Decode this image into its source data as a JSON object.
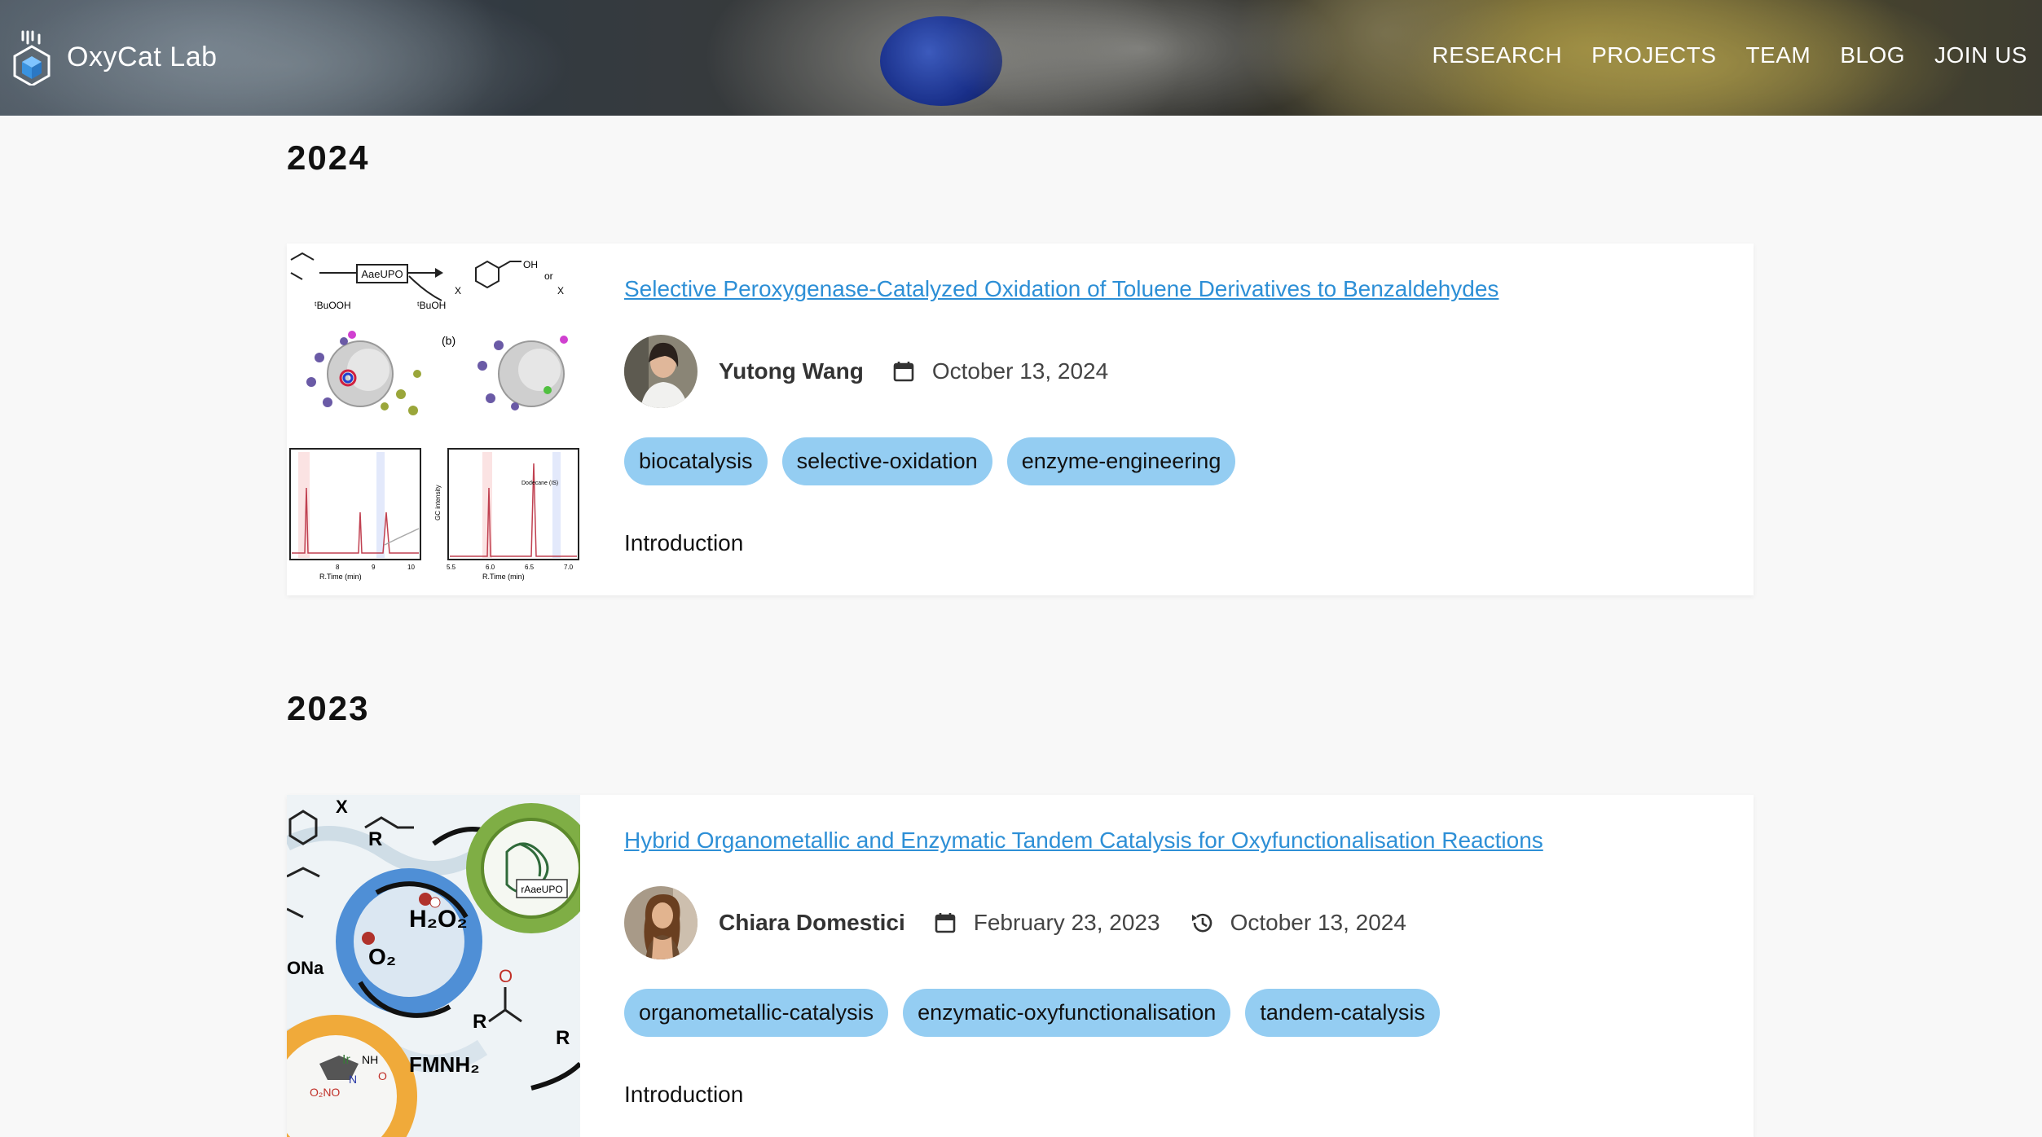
{
  "site": {
    "name": "OxyCat Lab",
    "logo_icon": "flask-cube-icon"
  },
  "nav": {
    "items": [
      {
        "label": "RESEARCH"
      },
      {
        "label": "PROJECTS"
      },
      {
        "label": "TEAM"
      },
      {
        "label": "BLOG"
      },
      {
        "label": "JOIN US"
      }
    ]
  },
  "sections": [
    {
      "year": "2024",
      "posts": [
        {
          "title": "Selective Peroxygenase-Catalyzed Oxidation of Toluene Derivatives to Benzaldehydes",
          "author": "Yutong Wang",
          "date_icon": "calendar-icon",
          "date": "October 13, 2024",
          "tags": [
            "biocatalysis",
            "selective-oxidation",
            "enzyme-engineering"
          ],
          "excerpt": "Introduction",
          "thumbnail_labels": [
            "AaeUPO",
            "ᵗBuOOH",
            "ᵗBuOH",
            "OH",
            "or",
            "X",
            "X",
            "(b)",
            "R.Time (min)",
            "R.Time (min)",
            "GC intensity",
            "Dodecane (IS)",
            "8",
            "9",
            "10",
            "5.5",
            "6.0",
            "6.5",
            "7.0"
          ]
        }
      ]
    },
    {
      "year": "2023",
      "posts": [
        {
          "title": "Hybrid Organometallic and Enzymatic Tandem Catalysis for Oxyfunctionalisation Reactions",
          "author": "Chiara Domestici",
          "date_icon": "calendar-icon",
          "date": "February 23, 2023",
          "updated_icon": "history-icon",
          "updated": "October 13, 2024",
          "tags": [
            "organometallic-catalysis",
            "enzymatic-oxyfunctionalisation",
            "tandem-catalysis"
          ],
          "excerpt": "Introduction",
          "thumbnail_labels": [
            "X",
            "R",
            "rAaeUPO",
            "H₂O₂",
            "O₂",
            "ONa",
            "R",
            "R",
            "O",
            "FMNH₂",
            "O₂NO",
            "Ir",
            "NH",
            "N",
            "O"
          ]
        }
      ]
    }
  ],
  "colors": {
    "link": "#2d8fd6",
    "tag_bg": "#94cdf2",
    "page_bg": "#f8f8f8"
  }
}
